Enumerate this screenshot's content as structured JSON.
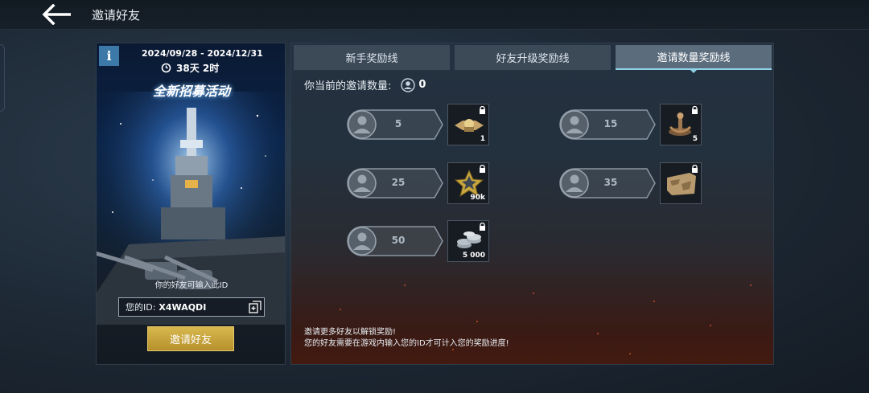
{
  "header": {
    "title": "邀请好友",
    "back_icon": "back-arrow-icon"
  },
  "event": {
    "date_range": "2024/09/28 - 2024/12/31",
    "countdown": "38天 2时",
    "title": "全新招募活动",
    "enter_hint": "你的好友可输入此ID",
    "id_label": "您的ID:",
    "id_value": "X4WAQDI",
    "invite_button": "邀请好友",
    "info_label": "i"
  },
  "tabs": [
    {
      "label": "新手奖励线",
      "active": false
    },
    {
      "label": "好友升级奖励线",
      "active": false
    },
    {
      "label": "邀请数量奖励线",
      "active": true
    }
  ],
  "invite_count": {
    "label": "你当前的邀请数量:",
    "value": "0"
  },
  "tiers": [
    {
      "threshold": "5",
      "reward_icon": "medal-badge-icon",
      "quantity": "1",
      "locked": true
    },
    {
      "threshold": "15",
      "reward_icon": "anchor-camouflage-icon",
      "quantity": "5",
      "locked": true
    },
    {
      "threshold": "25",
      "reward_icon": "star-xp-icon",
      "quantity": "90k",
      "locked": true
    },
    {
      "threshold": "35",
      "reward_icon": "camouflage-flag-icon",
      "quantity": "",
      "locked": true
    },
    {
      "threshold": "50",
      "reward_icon": "silver-coins-icon",
      "quantity": "5 000",
      "locked": true
    }
  ],
  "footer": {
    "line1": "邀请更多好友以解锁奖励!",
    "line2": "您的好友需要在游戏内输入您的ID才可计入您的奖励进度!"
  },
  "colors": {
    "accent_gold": "#c9a63d",
    "tab_active_underline": "#8fd3e8",
    "info_blue": "#3c79a8"
  }
}
